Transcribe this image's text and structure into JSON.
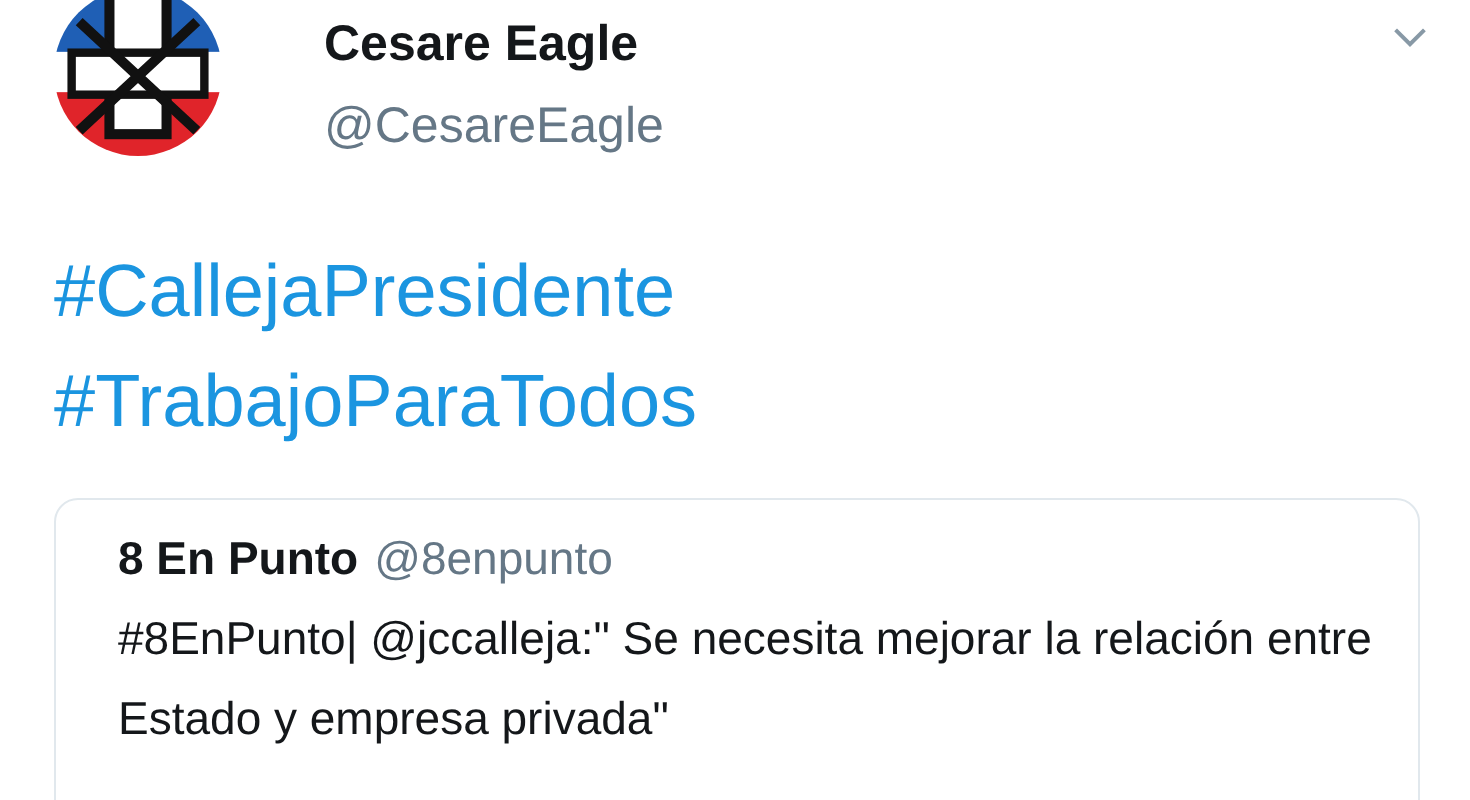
{
  "tweet": {
    "author_name": "Cesare Eagle",
    "author_handle": "@CesareEagle",
    "hashtags": [
      "#CallejaPresidente",
      "#TrabajoParaTodos"
    ],
    "quoted_tweet": {
      "author_name": "8 En Punto",
      "author_handle": "@8enpunto",
      "text": "#8EnPunto| @jccalleja:\" Se necesita mejorar la relación entre Estado y empresa privada\""
    }
  }
}
